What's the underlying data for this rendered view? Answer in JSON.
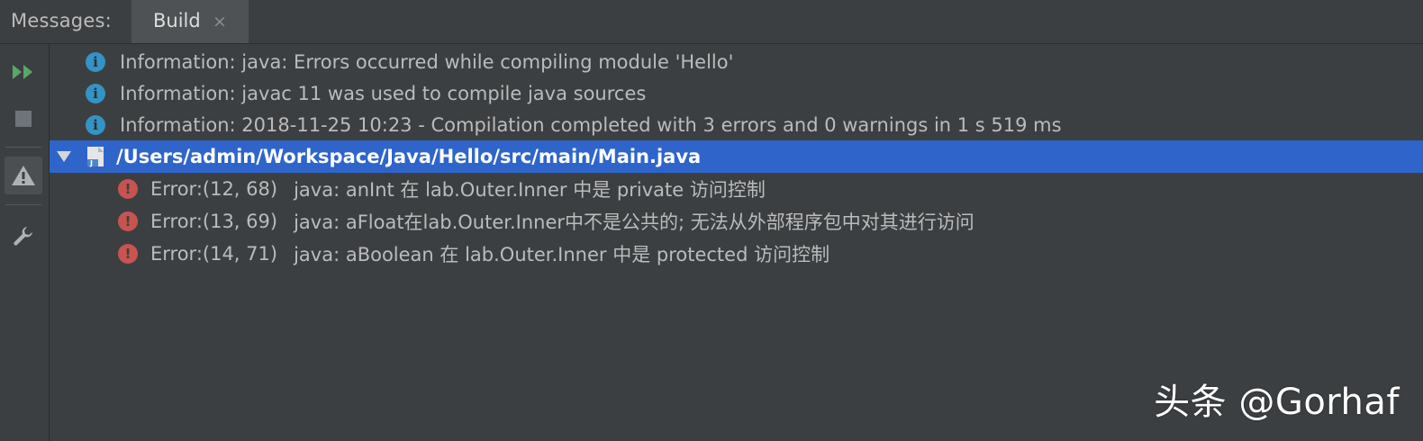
{
  "header": {
    "title": "Messages:",
    "tab_label": "Build",
    "tab_close": "×"
  },
  "toolbar": {
    "items": [
      {
        "name": "rerun",
        "icon": "rerun-icon",
        "color": "#59a869"
      },
      {
        "name": "stop",
        "icon": "stop-icon",
        "color": "#6f737a"
      },
      {
        "name": "warnings",
        "icon": "warning-icon",
        "color": "#afb1b3"
      },
      {
        "name": "settings",
        "icon": "wrench-icon",
        "color": "#afb1b3"
      }
    ]
  },
  "messages": {
    "info": [
      "Information: java: Errors occurred while compiling module 'Hello'",
      "Information: javac 11 was used to compile java sources",
      "Information: 2018-11-25 10:23 - Compilation completed with 3 errors and 0 warnings in 1 s 519 ms"
    ],
    "file": {
      "path": "/Users/admin/Workspace/Java/Hello/src/main/Main.java",
      "expanded": true
    },
    "errors": [
      {
        "code": "Error:(12, 68)",
        "message": "java: anInt 在 lab.Outer.Inner 中是 private 访问控制"
      },
      {
        "code": "Error:(13, 69)",
        "message": "java: aFloat在lab.Outer.Inner中不是公共的; 无法从外部程序包中对其进行访问"
      },
      {
        "code": "Error:(14, 71)",
        "message": "java: aBoolean 在 lab.Outer.Inner 中是 protected 访问控制"
      }
    ]
  },
  "watermark": "头条 @Gorhaf",
  "colors": {
    "background": "#3c3f41",
    "selection": "#2f65ca",
    "info": "#3592c4",
    "error": "#c75450",
    "run": "#59a869"
  }
}
